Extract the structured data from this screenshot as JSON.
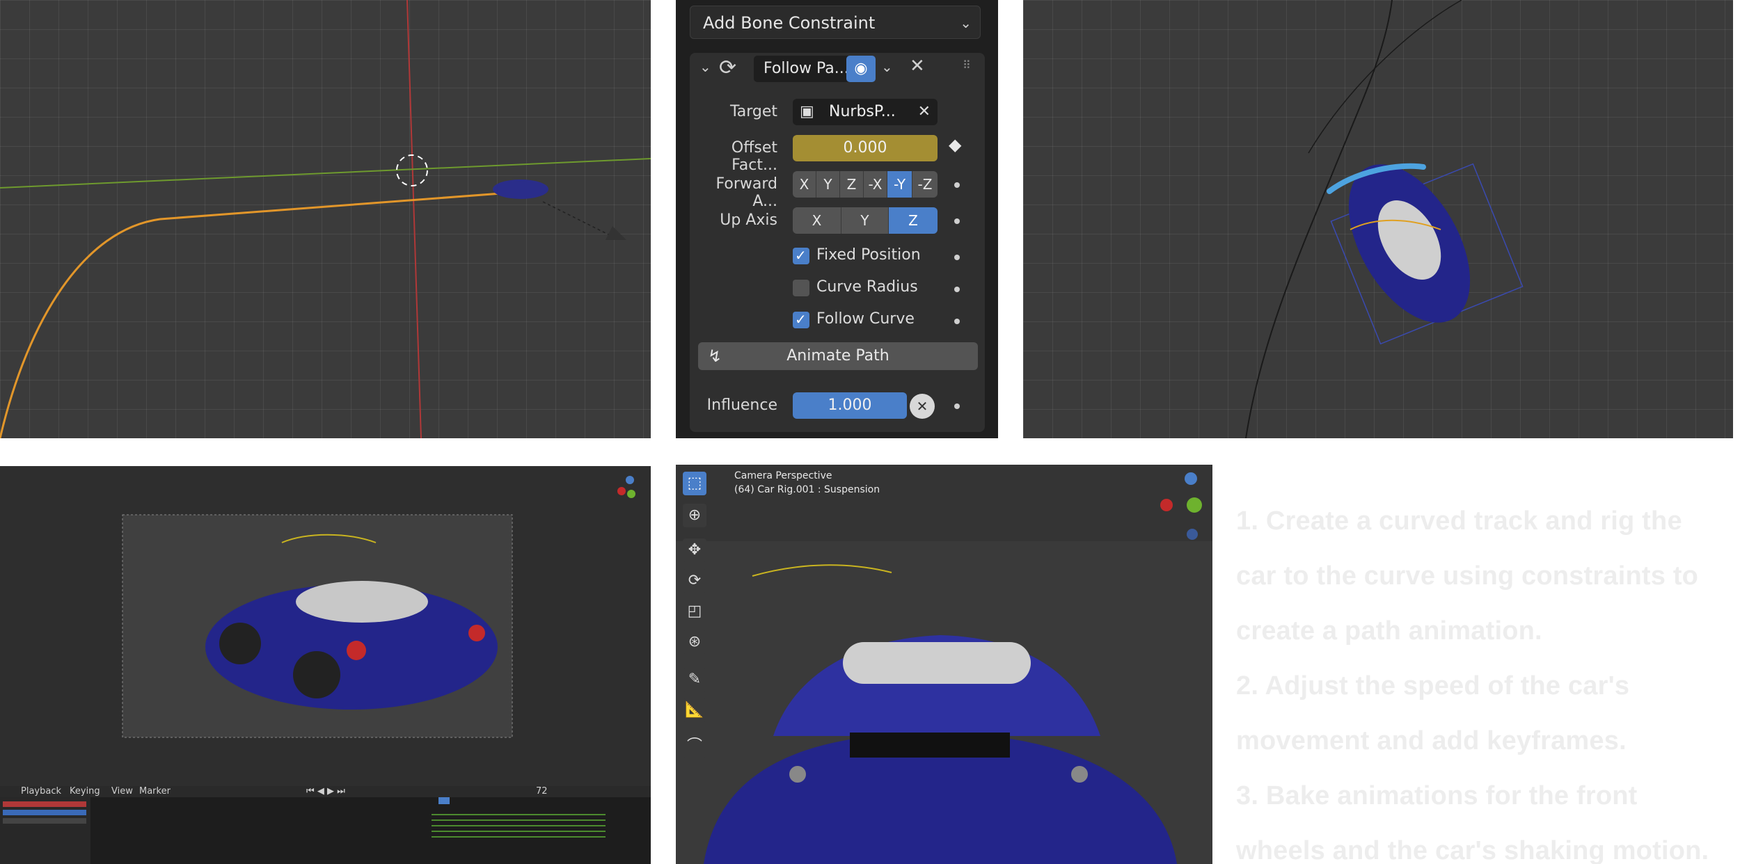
{
  "constraint_panel": {
    "add_menu_label": "Add Bone Constraint",
    "constraint_name": "Follow Pa...",
    "target_label": "Target",
    "target_value": "NurbsP...",
    "offset_label": "Offset Fact...",
    "offset_value": "0.000",
    "forward_label": "Forward A...",
    "forward_options": [
      "X",
      "Y",
      "Z",
      "-X",
      "-Y",
      "-Z"
    ],
    "forward_selected": "-Y",
    "up_label": "Up Axis",
    "up_options": [
      "X",
      "Y",
      "Z"
    ],
    "up_selected": "Z",
    "fixed_position_label": "Fixed Position",
    "fixed_position_checked": true,
    "curve_radius_label": "Curve Radius",
    "curve_radius_checked": false,
    "follow_curve_label": "Follow Curve",
    "follow_curve_checked": true,
    "animate_path_label": "Animate Path",
    "influence_label": "Influence",
    "influence_value": "1.000",
    "accent_color": "#4a7fc9",
    "offset_color": "#a48e33"
  },
  "camera_viewport": {
    "title": "Camera Perspective",
    "subtitle": "(64) Car Rig.001 : Suspension",
    "tools": [
      "select-box-icon",
      "cursor-icon",
      "move-icon",
      "rotate-icon",
      "scale-icon",
      "transform-icon",
      "annotate-icon",
      "measure-icon",
      "bone-icon"
    ]
  },
  "timeline_viewport": {
    "header_items": [
      "Playback",
      "Keying",
      "View",
      "Marker"
    ],
    "frame_value": "72"
  },
  "instructions": [
    "1. Create a curved track and rig the",
    "car to the curve using constraints to",
    "create a path animation.",
    "2. Adjust the speed of the car's",
    "movement and add keyframes.",
    "3. Bake animations for the front",
    "wheels and the car's shaking motion."
  ]
}
